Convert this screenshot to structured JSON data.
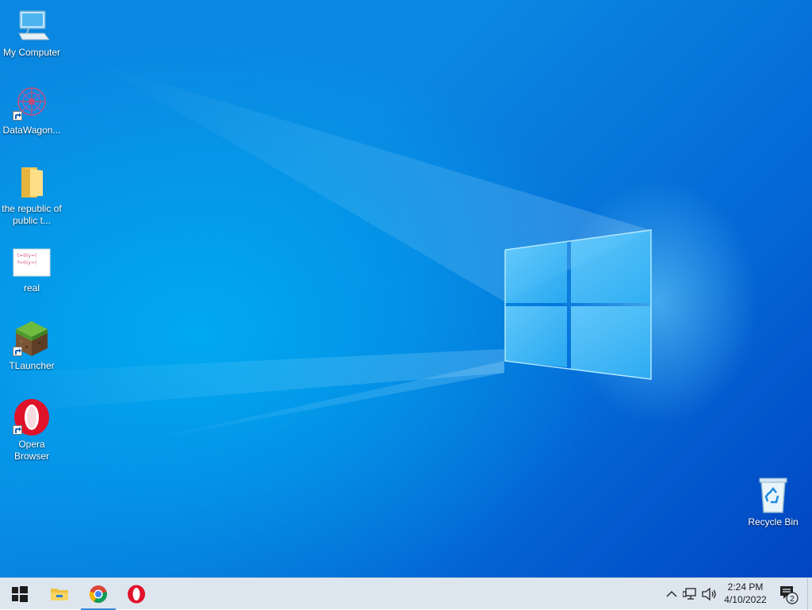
{
  "desktop": {
    "icons": [
      {
        "label": "My Computer"
      },
      {
        "label": "DataWagon..."
      },
      {
        "label": "the republic of public t..."
      },
      {
        "label": "real"
      },
      {
        "label": "TLauncher"
      },
      {
        "label": "Opera Browser"
      },
      {
        "label": "Recycle Bin"
      }
    ],
    "thumbnail_text": [
      "t=0(y=)",
      "f=0(y=)"
    ]
  },
  "taskbar": {
    "start_icon": "windows-logo-icon",
    "pinned": [
      {
        "name": "file-explorer",
        "icon": "folder-icon"
      },
      {
        "name": "google-chrome",
        "icon": "chrome-icon",
        "active": true
      },
      {
        "name": "opera",
        "icon": "opera-icon"
      }
    ],
    "tray": {
      "time": "2:24 PM",
      "date": "4/10/2022",
      "notification_count": "2"
    }
  },
  "colors": {
    "accent": "#0078d7",
    "taskbar": "#dde6ef",
    "opera_red": "#e0122a"
  }
}
